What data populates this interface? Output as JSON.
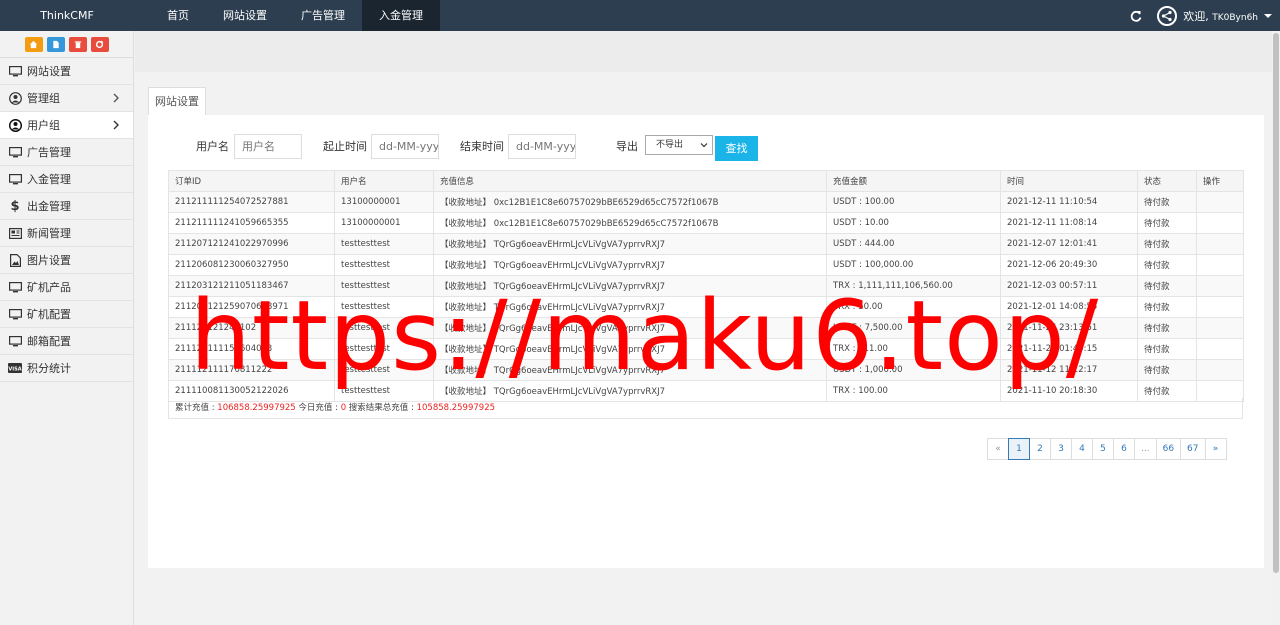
{
  "header": {
    "brand": "ThinkCMF",
    "tabs": [
      {
        "label": "首页"
      },
      {
        "label": "网站设置"
      },
      {
        "label": "广告管理"
      },
      {
        "label": "入金管理"
      }
    ],
    "welcome": "欢迎,",
    "username": "TK0Byn6h"
  },
  "sidebar": {
    "quick_buttons": [
      {
        "icon": "home-icon",
        "color": "#f39c12"
      },
      {
        "icon": "file-icon",
        "color": "#3498db"
      },
      {
        "icon": "trash-icon",
        "color": "#e74c3c"
      },
      {
        "icon": "recycle-icon",
        "color": "#e74c3c"
      }
    ],
    "items": [
      {
        "label": "网站设置",
        "icon": "monitor-icon"
      },
      {
        "label": "管理组",
        "icon": "user-circle-icon"
      },
      {
        "label": "用户组",
        "icon": "user-icon"
      },
      {
        "label": "广告管理",
        "icon": "monitor-icon"
      },
      {
        "label": "入金管理",
        "icon": "monitor-icon"
      },
      {
        "label": "出金管理",
        "icon": "dollar-icon"
      },
      {
        "label": "新闻管理",
        "icon": "newspaper-icon"
      },
      {
        "label": "图片设置",
        "icon": "image-icon"
      },
      {
        "label": "矿机产品",
        "icon": "monitor-icon"
      },
      {
        "label": "矿机配置",
        "icon": "monitor-icon"
      },
      {
        "label": "邮箱配置",
        "icon": "monitor-icon"
      },
      {
        "label": "积分统计",
        "icon": "visa-icon"
      }
    ]
  },
  "main": {
    "tab": "网站设置",
    "filters": {
      "username_label": "用户名",
      "username_placeholder": "用户名",
      "start_label": "起止时间",
      "start_placeholder": "dd-MM-yyyy",
      "end_label": "结束时间",
      "end_placeholder": "dd-MM-yyyy",
      "export_label": "导出",
      "export_value": "不导出",
      "search_label": "查找"
    },
    "table": {
      "headers": [
        "订单ID",
        "用户名",
        "充值信息",
        "充值金额",
        "时间",
        "状态",
        "操作"
      ],
      "rows": [
        [
          "211211111254072527881",
          "13100000001",
          "【收款地址】 0xc12B1E1C8e60757029bBE6529d65cC7572f1067B",
          "USDT : 100.00",
          "2021-12-11 11:10:54",
          "待付款",
          ""
        ],
        [
          "211211111241059665355",
          "13100000001",
          "【收款地址】 0xc12B1E1C8e60757029bBE6529d65cC7572f1067B",
          "USDT : 10.00",
          "2021-12-11 11:08:14",
          "待付款",
          ""
        ],
        [
          "211207121241022970996",
          "testtesttest",
          "【收款地址】 TQrGg6oeavEHrmLJcVLiVgVA7yprrvRXJ7",
          "USDT : 444.00",
          "2021-12-07 12:01:41",
          "待付款",
          ""
        ],
        [
          "211206081230060327950",
          "testtesttest",
          "【收款地址】 TQrGg6oeavEHrmLJcVLiVgVA7yprrvRXJ7",
          "USDT : 100,000.00",
          "2021-12-06 20:49:30",
          "待付款",
          ""
        ],
        [
          "211203121211051183467",
          "testtesttest",
          "【收款地址】 TQrGg6oeavEHrmLJcVLiVgVA7yprrvRXJ7",
          "TRX : 1,111,111,106,560.00",
          "2021-12-03 00:57:11",
          "待付款",
          ""
        ],
        [
          "211201121259070668971",
          "testtesttest",
          "【收款地址】 TQrGg6oeavEHrmLJcVLiVgVA7yprrvRXJ7",
          "TRX : 50.00",
          "2021-12-01 14:08:55",
          "待付款",
          ""
        ],
        [
          "211126121241102",
          "testtesttest",
          "【收款地址】 TQrGg6oeavEHrmLJcVLiVgVA7yprrvRXJ7",
          "USDT : 7,500.00",
          "2021-11-26 23:13:51",
          "待付款",
          ""
        ],
        [
          "211121111150604053",
          "testtesttest",
          "【收款地址】 TQrGg6oeavEHrmLJcVLiVgVA7yprrvRXJ7",
          "TRX : 111.00",
          "2021-11-21 01:40:15",
          "待付款",
          ""
        ],
        [
          "211112111170811222",
          "testtesttest",
          "【收款地址】 TQrGg6oeavEHrmLJcVLiVgVA7yprrvRXJ7",
          "USDT : 1,000.00",
          "2021-11-12 11:12:17",
          "待付款",
          ""
        ],
        [
          "211110081130052122026",
          "testtesttest",
          "【收款地址】 TQrGg6oeavEHrmLJcVLiVgVA7yprrvRXJ7",
          "TRX : 100.00",
          "2021-11-10 20:18:30",
          "待付款",
          ""
        ]
      ],
      "summary": {
        "total_label": "累计充值 : ",
        "total_value": "106858.25997925",
        "today_label": " 今日充值 : ",
        "today_value": "0",
        "search_total_label": " 搜索结果总充值 : ",
        "search_total_value": "105858.25997925"
      }
    },
    "pagination": [
      "«",
      "1",
      "2",
      "3",
      "4",
      "5",
      "6",
      "...",
      "66",
      "67",
      "»"
    ],
    "current_page": "1"
  },
  "watermark": "https://maku6.top/",
  "colors": {
    "topbar": "#2c3e50",
    "search_button": "#1ab4e8",
    "highlight_red": "#e22222",
    "watermark": "#ff0000"
  }
}
